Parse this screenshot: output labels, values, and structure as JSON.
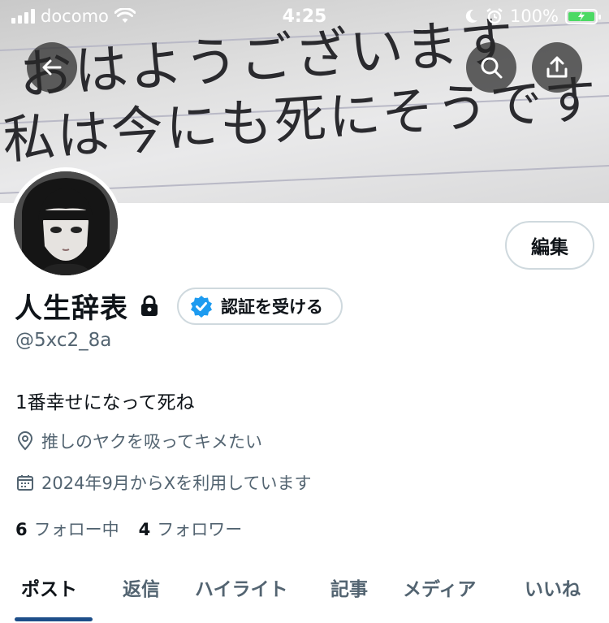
{
  "status_bar": {
    "carrier": "docomo",
    "time": "4:25",
    "battery_percent": "100%"
  },
  "banner": {
    "line1": "おはようございます",
    "line2": "私は今にも死にそうです"
  },
  "profile": {
    "name": "人生辞表",
    "handle": "@5xc2_8a",
    "bio": "1番幸せになって死ね",
    "location": "推しのヤクを吸ってキメたい",
    "joined": "2024年9月からXを利用しています",
    "following_count": "6",
    "following_label": "フォロー中",
    "followers_count": "4",
    "followers_label": "フォロワー"
  },
  "buttons": {
    "edit": "編集",
    "verify": "認証を受ける"
  },
  "tabs": [
    "ポスト",
    "返信",
    "ハイライト",
    "記事",
    "メディア",
    "いいね"
  ],
  "colors": {
    "accent": "#1d9bf0",
    "tab_underline": "#1d4e89",
    "muted_text": "#536471",
    "battery_fill": "#4cd964"
  },
  "icons": {
    "back": "arrow-left-icon",
    "search": "search-icon",
    "share": "share-icon",
    "lock": "lock-icon",
    "verified": "verified-badge-icon",
    "location": "location-pin-icon",
    "calendar": "calendar-icon"
  }
}
